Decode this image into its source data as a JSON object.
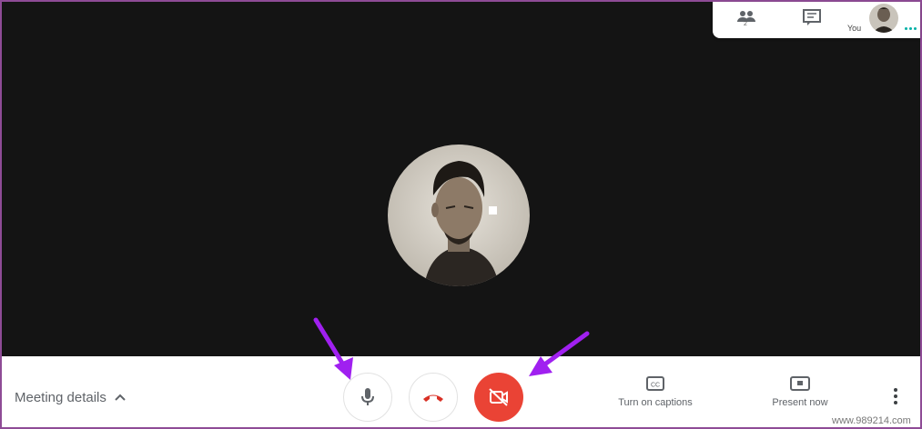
{
  "top_panel": {
    "participants_count": "2",
    "you_label": "You",
    "icons": {
      "participants": "people-icon",
      "chat": "chat-icon"
    }
  },
  "bottom_bar": {
    "meeting_details_label": "Meeting details",
    "captions_label": "Turn on captions",
    "present_label": "Present now"
  },
  "controls": {
    "mic_icon": "microphone-icon",
    "hangup_icon": "hang-up-icon",
    "camera_icon": "camera-off-icon",
    "camera_color": "#ea4335",
    "hangup_color": "#d93025"
  },
  "annotation": {
    "arrow_color": "#a020f0"
  },
  "watermark": "www.989214.com"
}
